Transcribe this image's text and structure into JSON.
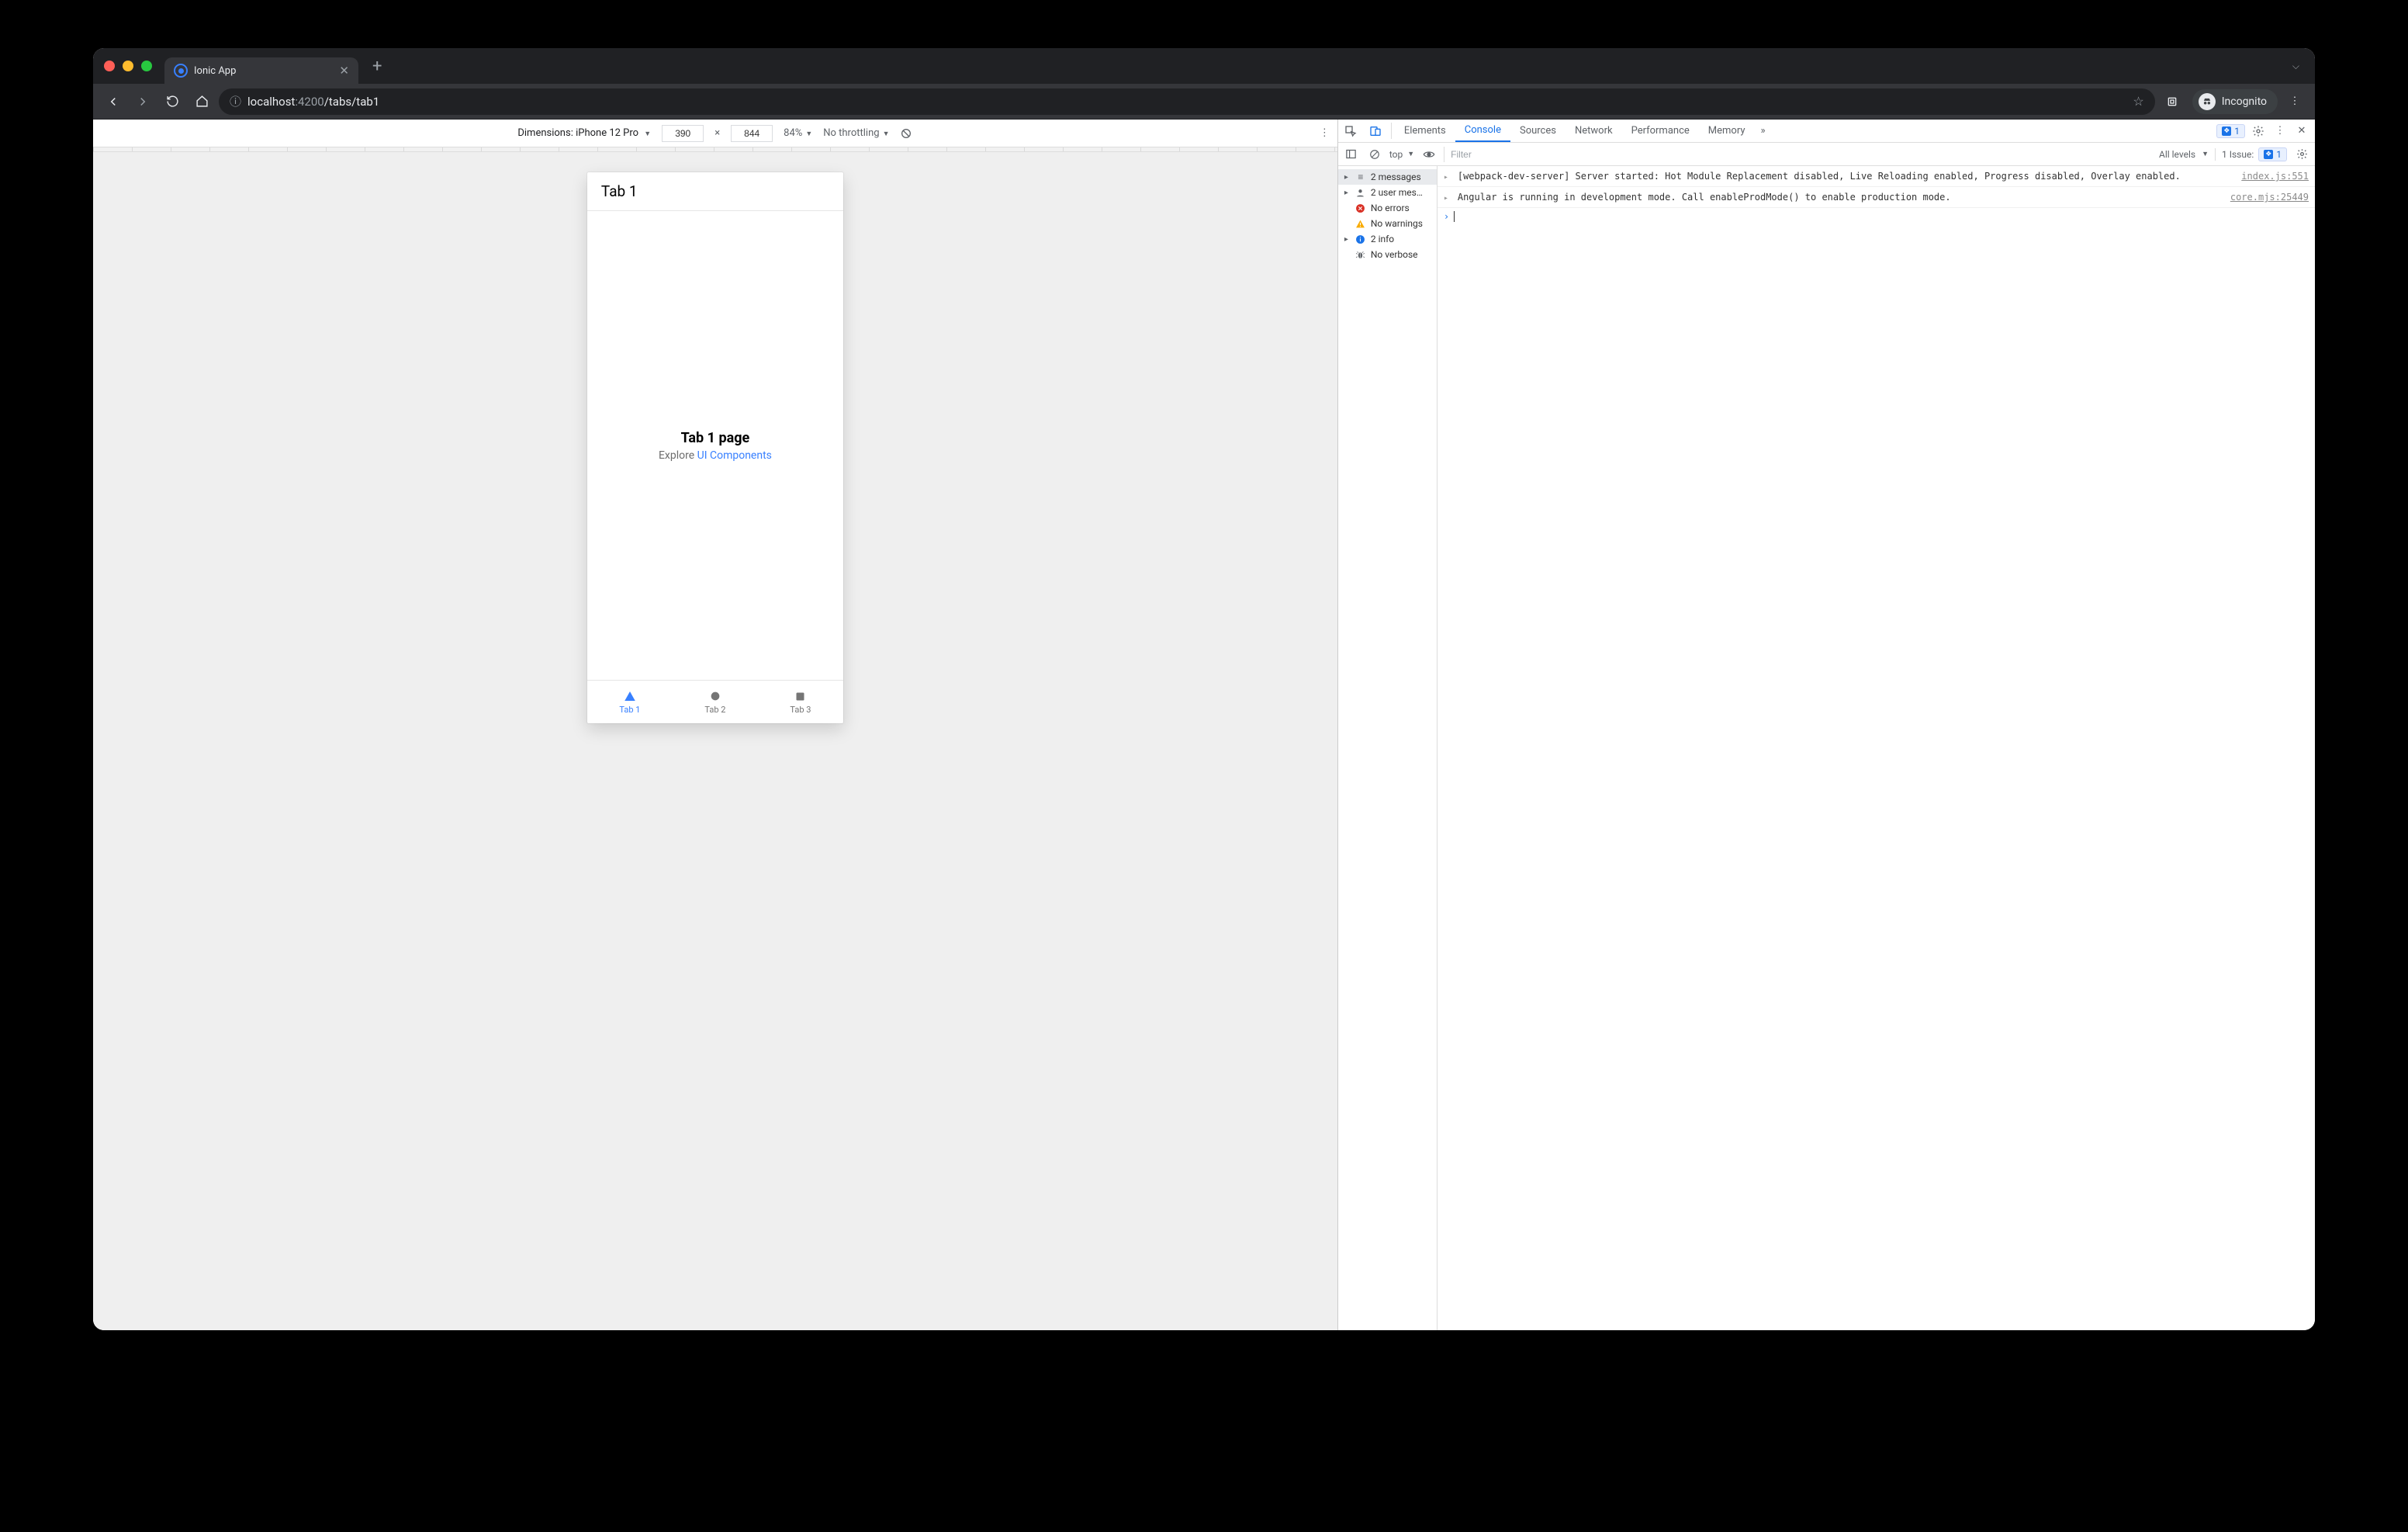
{
  "browser": {
    "tab_title": "Ionic App",
    "url_host": "localhost",
    "url_port": ":4200",
    "url_path": "/tabs/tab1",
    "incognito_label": "Incognito"
  },
  "device_bar": {
    "dimensions_label": "Dimensions:",
    "device_name": "iPhone 12 Pro",
    "width": "390",
    "height": "844",
    "zoom": "84%",
    "throttling": "No throttling"
  },
  "app": {
    "header_title": "Tab 1",
    "content_title": "Tab 1 page",
    "content_sub_prefix": "Explore ",
    "content_sub_link": "UI Components",
    "tabs": [
      {
        "label": "Tab 1"
      },
      {
        "label": "Tab 2"
      },
      {
        "label": "Tab 3"
      }
    ]
  },
  "devtools": {
    "tabs": {
      "elements": "Elements",
      "console": "Console",
      "sources": "Sources",
      "network": "Network",
      "performance": "Performance",
      "memory": "Memory"
    },
    "badge_count": "1",
    "row2": {
      "context": "top",
      "filter_placeholder": "Filter",
      "levels_label": "All levels",
      "issues_label": "1 Issue:",
      "issues_count": "1"
    },
    "sidebar": {
      "messages": "2 messages",
      "user": "2 user mes…",
      "errors": "No errors",
      "warnings": "No warnings",
      "info": "2 info",
      "verbose": "No verbose"
    },
    "logs": [
      {
        "msg": "[webpack-dev-server] Server started: Hot Module Replacement disabled, Live Reloading enabled, Progress disabled, Overlay enabled.",
        "src": "index.js:551"
      },
      {
        "msg": "Angular is running in development mode. Call enableProdMode() to enable production mode.",
        "src": "core.mjs:25449"
      }
    ]
  }
}
